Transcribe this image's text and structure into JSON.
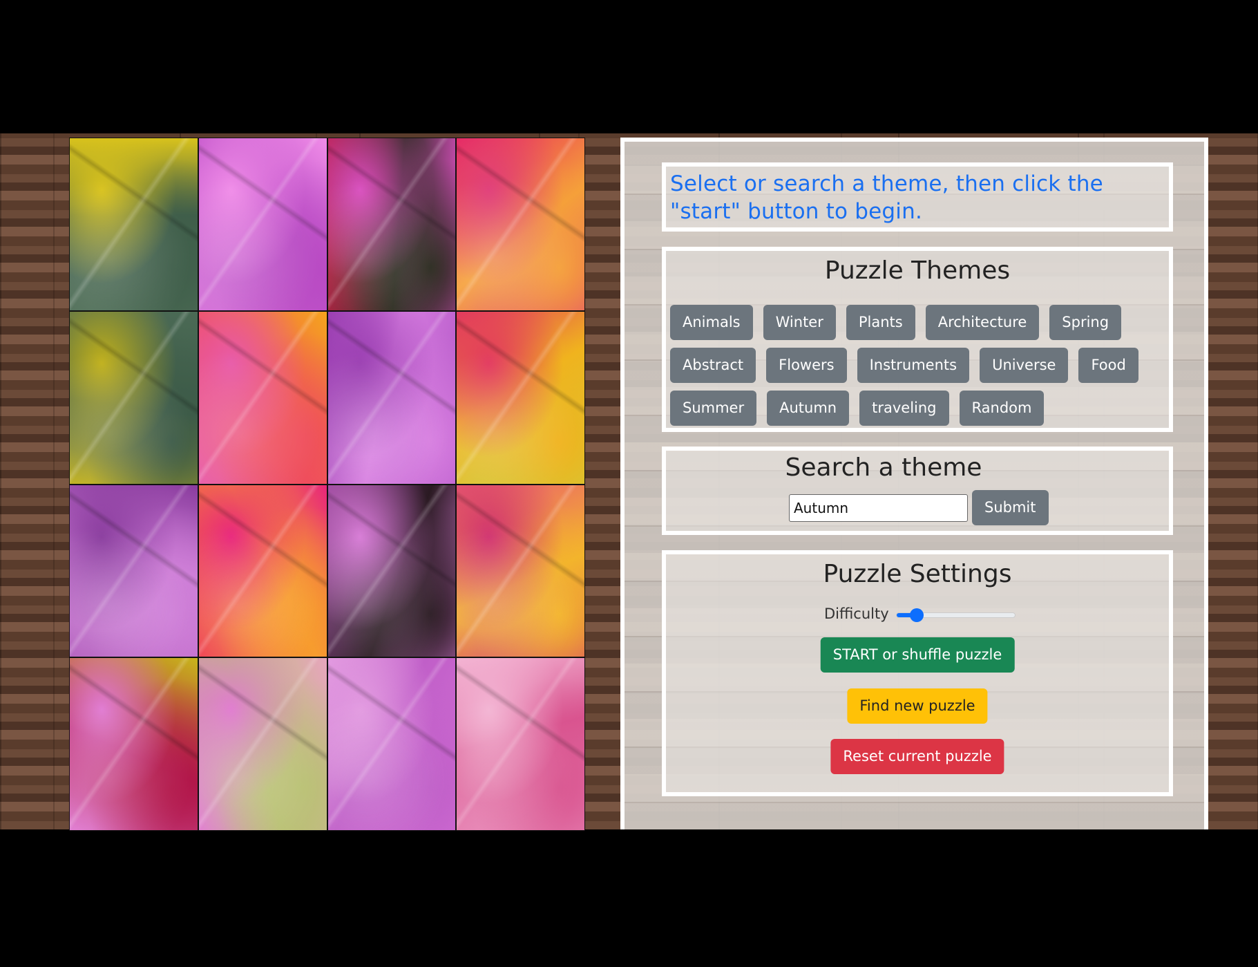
{
  "puzzle": {
    "tiles": [
      {
        "colors": [
          "#4f6e57",
          "#3f5e4a",
          "#d8c21c"
        ]
      },
      {
        "colors": [
          "#d46fd8",
          "#b94bc4",
          "#f08ce8"
        ]
      },
      {
        "colors": [
          "#b5173c",
          "#2a2a1e",
          "#d94fbf"
        ]
      },
      {
        "colors": [
          "#e8215e",
          "#f5a03a",
          "#e03d78"
        ]
      },
      {
        "colors": [
          "#4b6a55",
          "#3d5b48",
          "#c0b01b"
        ]
      },
      {
        "colors": [
          "#f5a41d",
          "#ef4e5c",
          "#e85aa8"
        ]
      },
      {
        "colors": [
          "#b255c6",
          "#d77ee0",
          "#9b3fb2"
        ]
      },
      {
        "colors": [
          "#c8cf3d",
          "#f0b31e",
          "#e2395e"
        ]
      },
      {
        "colors": [
          "#b45fbf",
          "#cf7fd8",
          "#8a3c9e"
        ]
      },
      {
        "colors": [
          "#ee3f4f",
          "#f79c2e",
          "#e8267b"
        ]
      },
      {
        "colors": [
          "#8c3b8e",
          "#2a1a22",
          "#d77bd6"
        ]
      },
      {
        "colors": [
          "#ea5c70",
          "#f3b42c",
          "#d1336f"
        ]
      },
      {
        "colors": [
          "#c8b51b",
          "#b2174a",
          "#e07ad2"
        ]
      },
      {
        "colors": [
          "#e7a5bd",
          "#b9c173",
          "#e07bcf"
        ]
      },
      {
        "colors": [
          "#d46fd6",
          "#c05fc8",
          "#e29ae0"
        ]
      },
      {
        "colors": [
          "#ea8fbd",
          "#d9548f",
          "#f3b4d3"
        ]
      }
    ]
  },
  "instructions": {
    "text": "Select or search a theme, then click the \"start\" button to begin.",
    "color": "#1a6ff0"
  },
  "themes": {
    "title": "Puzzle Themes",
    "rows": [
      [
        "Animals",
        "Winter",
        "Plants",
        "Architecture",
        "Spring"
      ],
      [
        "Abstract",
        "Flowers",
        "Instruments",
        "Universe",
        "Food"
      ],
      [
        "Summer",
        "Autumn",
        "traveling",
        "Random"
      ]
    ]
  },
  "search": {
    "title": "Search a theme",
    "value": "Autumn",
    "submit_label": "Submit"
  },
  "settings": {
    "title": "Puzzle Settings",
    "difficulty_label": "Difficulty",
    "difficulty_value": 0.17,
    "start_label": "START or shuffle puzzle",
    "find_label": "Find new puzzle",
    "reset_label": "Reset current puzzle",
    "colors": {
      "start": "#198754",
      "find": "#ffc107",
      "reset": "#dc3545",
      "theme_button": "#6c757d",
      "slider": "#0d6efd"
    }
  }
}
